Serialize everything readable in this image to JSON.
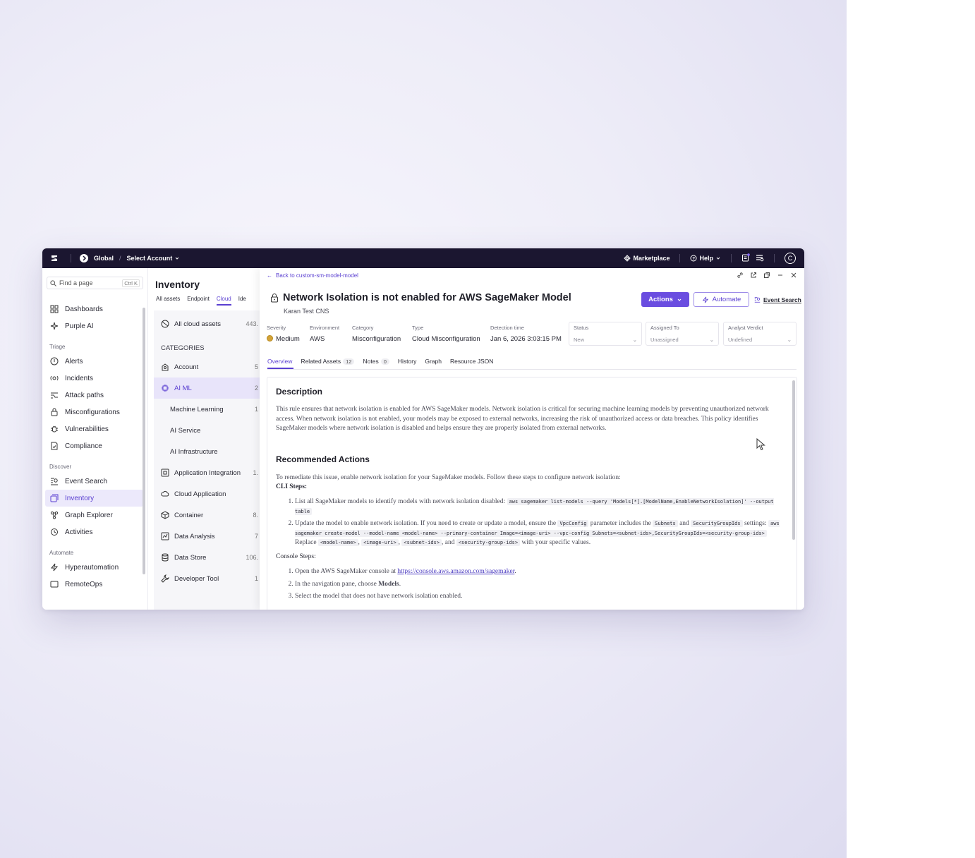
{
  "topbar": {
    "scope": "Global",
    "account": "Select Account",
    "marketplace": "Marketplace",
    "help": "Help",
    "avatar_letter": "C"
  },
  "sidebar": {
    "search_placeholder": "Find a page",
    "search_shortcut": "Ctrl K",
    "items_top": [
      {
        "label": "Dashboards",
        "icon": "grid-icon"
      },
      {
        "label": "Purple AI",
        "icon": "purple-ai-icon"
      }
    ],
    "sections": [
      {
        "title": "Triage",
        "items": [
          "Alerts",
          "Incidents",
          "Attack paths",
          "Misconfigurations",
          "Vulnerabilities",
          "Compliance"
        ]
      },
      {
        "title": "Discover",
        "items": [
          "Event Search",
          "Inventory",
          "Graph Explorer",
          "Activities"
        ]
      },
      {
        "title": "Automate",
        "items": [
          "Hyperautomation",
          "RemoteOps"
        ]
      }
    ],
    "active_item": "Inventory"
  },
  "inventory": {
    "title": "Inventory",
    "tabs": [
      "All assets",
      "Endpoint",
      "Cloud",
      "Ide"
    ],
    "active_tab": "Cloud",
    "all_cloud_assets": {
      "label": "All cloud assets",
      "count": "443."
    },
    "categories_heading": "CATEGORIES",
    "categories": [
      {
        "label": "Account",
        "count": "5",
        "sub": false
      },
      {
        "label": "AI ML",
        "count": "2",
        "sub": false,
        "active": true
      },
      {
        "label": "Machine Learning",
        "count": "1",
        "sub": true
      },
      {
        "label": "AI Service",
        "count": "",
        "sub": true
      },
      {
        "label": "AI Infrastructure",
        "count": "",
        "sub": true
      },
      {
        "label": "Application Integration",
        "count": "1.",
        "sub": false
      },
      {
        "label": "Cloud Application",
        "count": "",
        "sub": false
      },
      {
        "label": "Container",
        "count": "8.",
        "sub": false
      },
      {
        "label": "Data Analysis",
        "count": "7",
        "sub": false
      },
      {
        "label": "Data Store",
        "count": "106.",
        "sub": false
      },
      {
        "label": "Developer Tool",
        "count": "1",
        "sub": false
      }
    ]
  },
  "detail": {
    "back_label": "Back to custom-sm-model-model",
    "title": "Network Isolation is not enabled for AWS SageMaker Model",
    "subtitle": "Karan Test CNS",
    "actions_label": "Actions",
    "automate_label": "Automate",
    "event_search_label": "Event Search",
    "meta": [
      {
        "label": "Severity",
        "value": "Medium"
      },
      {
        "label": "Environment",
        "value": "AWS"
      },
      {
        "label": "Category",
        "value": "Misconfiguration"
      },
      {
        "label": "Type",
        "value": "Cloud Misconfiguration"
      },
      {
        "label": "Detection time",
        "value": "Jan 6, 2026 3:03:15 PM"
      }
    ],
    "selects": [
      {
        "label": "Status",
        "value": "New"
      },
      {
        "label": "Assigned To",
        "value": "Unassigned"
      },
      {
        "label": "Analyst Verdict",
        "value": "Undefined"
      }
    ],
    "tabs": [
      {
        "label": "Overview",
        "badge": ""
      },
      {
        "label": "Related Assets",
        "badge": "12"
      },
      {
        "label": "Notes",
        "badge": "0"
      },
      {
        "label": "History",
        "badge": ""
      },
      {
        "label": "Graph",
        "badge": ""
      },
      {
        "label": "Resource JSON",
        "badge": ""
      }
    ],
    "active_tab": "Overview",
    "description_heading": "Description",
    "description_text": "This rule ensures that network isolation is enabled for AWS SageMaker models. Network isolation is critical for securing machine learning models by preventing unauthorized network access. When network isolation is not enabled, your models may be exposed to external networks, increasing the risk of unauthorized access or data breaches. This policy identifies SageMaker models where network isolation is disabled and helps ensure they are properly isolated from external networks.",
    "recommended_heading": "Recommended Actions",
    "recommended_intro": "To remediate this issue, enable network isolation for your SageMaker models. Follow these steps to configure network isolation:",
    "cli_heading": "CLI Steps:",
    "cli_step1_text": "List all SageMaker models to identify models with network isolation disabled:",
    "cli_step1_code": "aws sagemaker list-models --query 'Models[*].[ModelName,EnableNetworkIsolation]' --output table",
    "cli_step2_text_a": "Update the model to enable network isolation. If you need to create or update a model, ensure the",
    "cli_step2_code_a": "VpcConfig",
    "cli_step2_text_b": "parameter includes the",
    "cli_step2_code_b": "Subnets",
    "cli_step2_text_c": "and",
    "cli_step2_code_c": "SecurityGroupIds",
    "cli_step2_text_d": "settings:",
    "cli_step2_code_d": "aws sagemaker create-model --model-name <model-name> --primary-container Image=<image-uri> --vpc-config Subnets=<subnet-ids>,SecurityGroupIds=<security-group-ids>",
    "cli_step2_text_e": "Replace",
    "cli_step2_code_e": "<model-name>",
    "cli_step2_code_f": "<image-uri>",
    "cli_step2_code_g": "<subnet-ids>",
    "cli_step2_text_f": ", and",
    "cli_step2_code_h": "<security-group-ids>",
    "cli_step2_text_g": "with your specific values.",
    "console_heading": "Console Steps:",
    "console_step1_text": "Open the AWS SageMaker console at",
    "console_step1_link": "https://console.aws.amazon.com/sagemaker",
    "console_step2_text": "In the navigation pane, choose",
    "console_step2_bold": "Models",
    "console_step3_text": "Select the model that does not have network isolation enabled."
  }
}
